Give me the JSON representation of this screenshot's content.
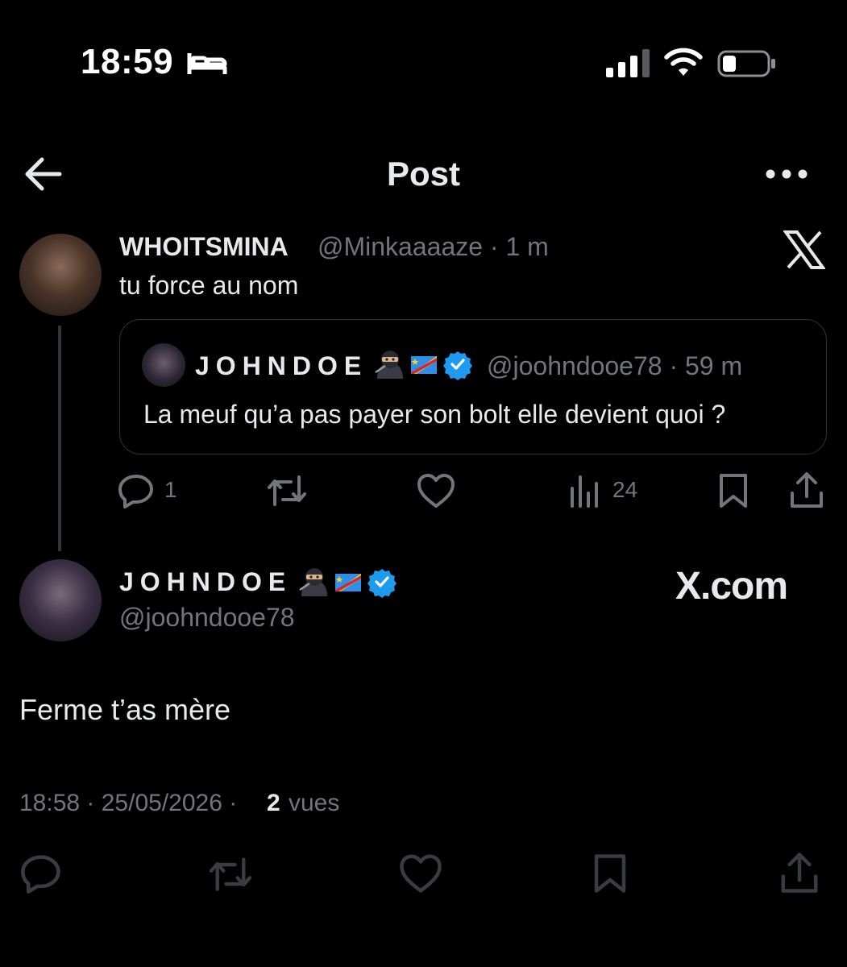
{
  "status_bar": {
    "time": "18:59"
  },
  "header": {
    "title": "Post"
  },
  "tweet1": {
    "name": "WHOITSMINA",
    "handle_time": "@Minkaaaaze · 1 m",
    "text": "tu force au nom",
    "quote": {
      "name": "JOHNDOE",
      "handle_time": "@joohndooe78 · 59 m",
      "text": "La meuf qu’a pas payer son bolt elle devient quoi ?"
    },
    "actions": {
      "replies": "1",
      "views": "24"
    }
  },
  "main_tweet": {
    "name": "JOHNDOE",
    "handle": "@joohndooe78",
    "watermark": "X.com",
    "text": "Ferme t’as mère",
    "meta": {
      "time_date": "18:58 · 25/05/2026 ·",
      "views_count": "2",
      "views_label": "vues"
    }
  },
  "colors": {
    "background": "#000000",
    "text": "#e7e9ea",
    "muted": "#71767b",
    "verified": "#1d9bf0",
    "border": "#2f3336"
  },
  "icons": [
    "bed-icon",
    "signal-icon",
    "wifi-icon",
    "battery-icon",
    "back-arrow-icon",
    "more-icon",
    "x-logo-icon",
    "verified-badge-icon",
    "flag-icon",
    "ninja-icon",
    "reply-icon",
    "retweet-icon",
    "like-icon",
    "views-icon",
    "bookmark-icon",
    "share-icon"
  ]
}
